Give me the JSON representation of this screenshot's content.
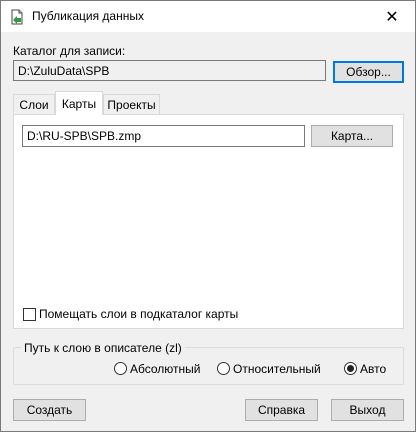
{
  "window": {
    "title": "Публикация данных",
    "close_glyph": "✕"
  },
  "catalog": {
    "label": "Каталог для записи:",
    "path": "D:\\ZuluData\\SPB",
    "browse_label": "Обзор..."
  },
  "tabs": [
    {
      "label": "Слои",
      "active": false
    },
    {
      "label": "Карты",
      "active": true
    },
    {
      "label": "Проекты",
      "active": false
    }
  ],
  "maps_tab": {
    "map_path": "D:\\RU-SPB\\SPB.zmp",
    "map_button_label": "Карта...",
    "subfolder_checkbox_label": "Помещать слои в подкаталог карты",
    "subfolder_checked": false
  },
  "layer_path": {
    "group_title": "Путь к слою в описателе (zl)",
    "options": [
      {
        "label": "Абсолютный",
        "selected": false
      },
      {
        "label": "Относительный",
        "selected": false
      },
      {
        "label": "Авто",
        "selected": true
      }
    ]
  },
  "buttons": {
    "create": "Создать",
    "help": "Справка",
    "exit": "Выход"
  },
  "colors": {
    "accent": "#0078d7",
    "icon_green": "#2e9b3e"
  }
}
